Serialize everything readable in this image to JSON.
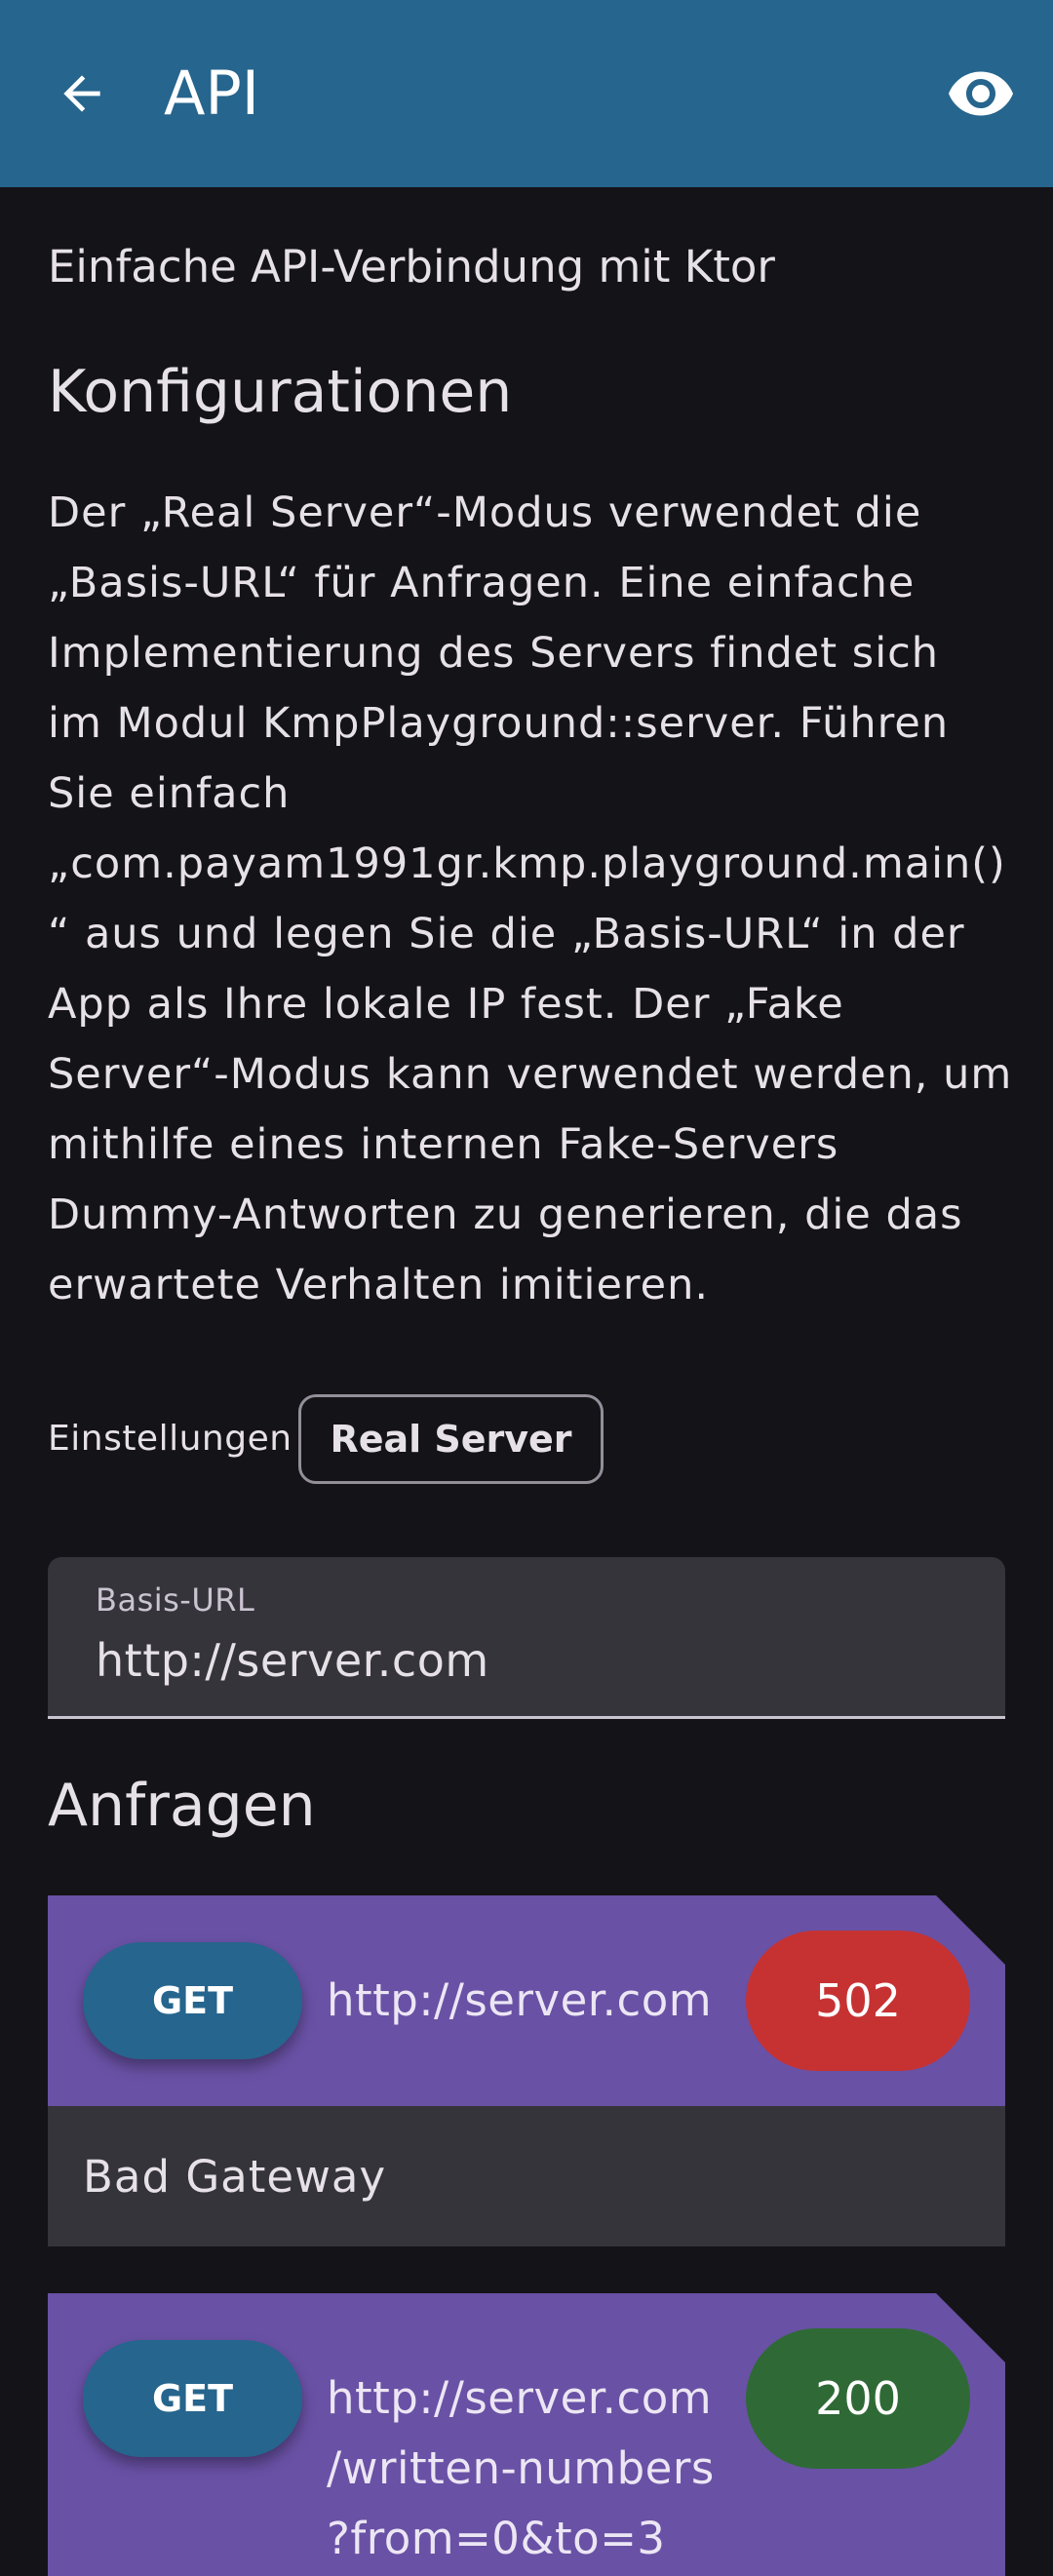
{
  "appbar": {
    "title": "API",
    "back_icon": "arrow-back-icon",
    "action_icon": "eye-icon",
    "color": "#26658d"
  },
  "subtitle": "Einfache API-Verbindung mit Ktor",
  "config": {
    "heading": "Konfigurationen",
    "description": "Der „Real Server“-Modus verwendet die\n„Basis-URL“ für Anfragen. Eine einfache\nImplementierung des Servers findet sich\nim Modul KmpPlayground::server. Führen\nSie einfach\n„com.payam1991gr.kmp.playground.main()\n“ aus und legen Sie die „Basis-URL“ in der\nApp als Ihre lokale IP fest. Der „Fake\nServer“-Modus kann verwendet werden, um\nmithilfe eines internen Fake-Servers\nDummy-Antworten zu generieren, die das\nerwartete Verhalten imitieren."
  },
  "settings": {
    "label": "Einstellungen",
    "mode_button": "Real Server"
  },
  "base_url": {
    "label": "Basis-URL",
    "value": "http://server.com"
  },
  "requests": {
    "heading": "Anfragen",
    "items": [
      {
        "method": "GET",
        "url": "http://server.com",
        "status": "502",
        "status_color": "#c63232",
        "message": "Bad Gateway"
      },
      {
        "method": "GET",
        "url": "http://server.com\n/written-numbers\n?from=0&to=3",
        "status": "200",
        "status_color": "#2f6a36"
      }
    ]
  }
}
